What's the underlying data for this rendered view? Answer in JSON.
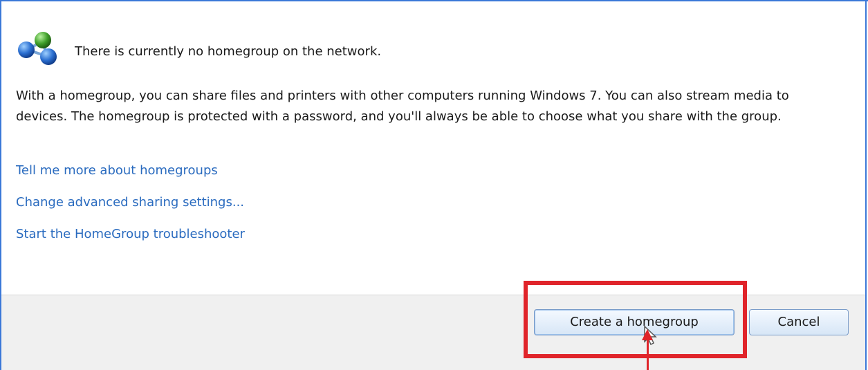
{
  "dialog": {
    "headline": "There is currently no homegroup on the network.",
    "description": "With a homegroup, you can share files and printers with other computers running Windows 7. You can also stream media to devices. The homegroup is protected with a password, and you'll always be able to choose what you share with the group.",
    "icon": "homegroup-network-icon"
  },
  "links": {
    "tell_more": "Tell me more about homegroups",
    "advanced_sharing": "Change advanced sharing settings...",
    "troubleshooter": "Start the HomeGroup troubleshooter"
  },
  "footer": {
    "create_label": "Create a homegroup",
    "cancel_label": "Cancel"
  },
  "annotation": {
    "highlight_color": "#e0242a",
    "accent_color": "#3b78d8",
    "link_color": "#2a6bbf"
  }
}
